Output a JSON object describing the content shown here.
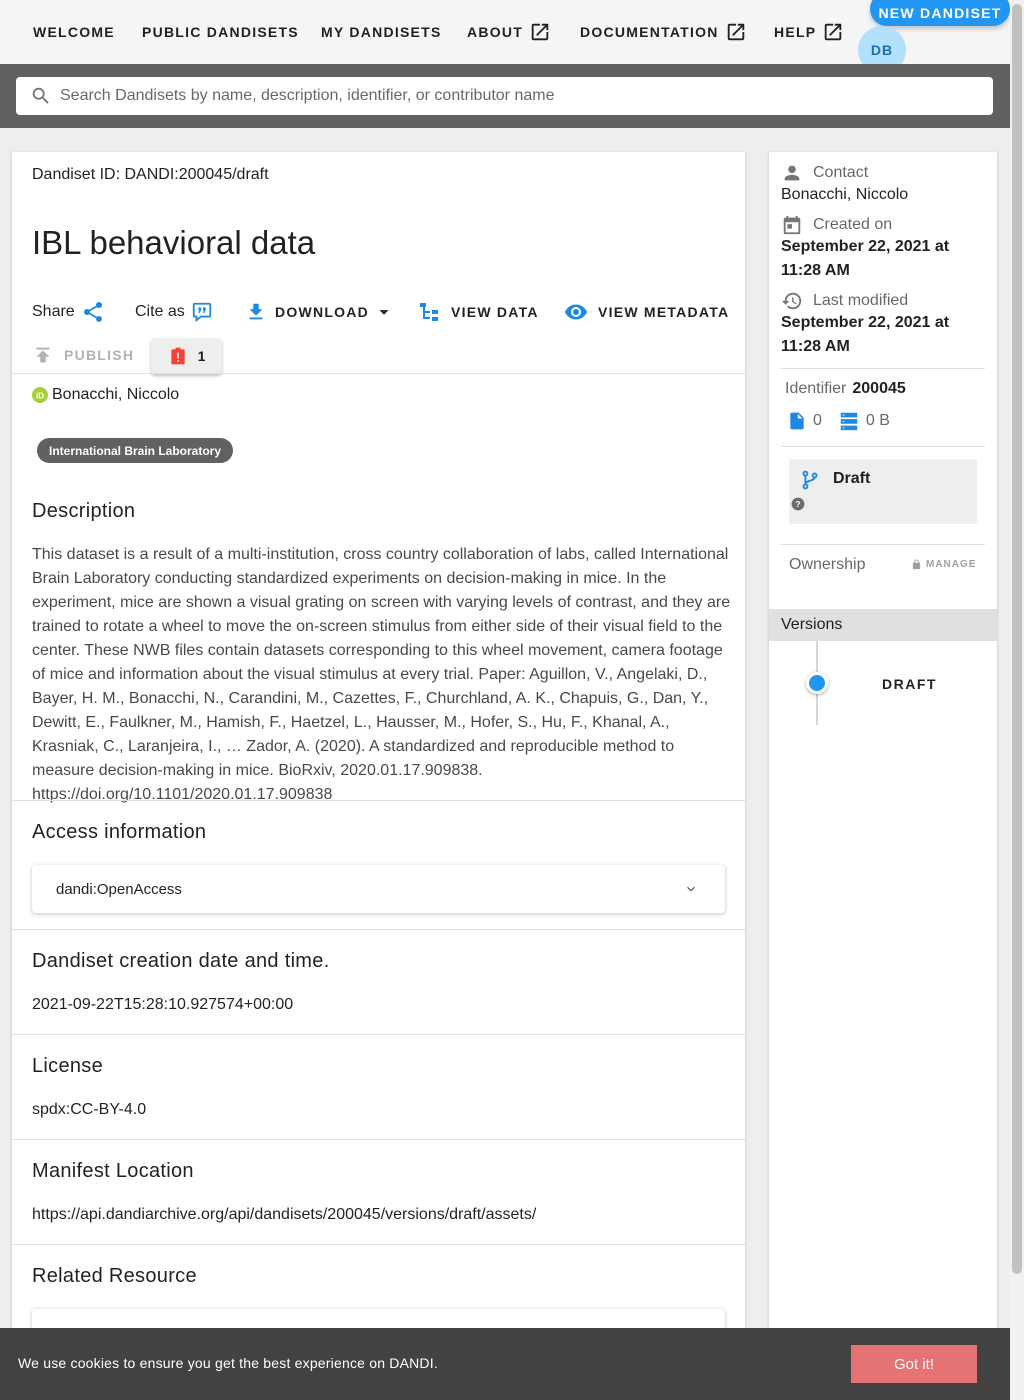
{
  "nav": {
    "items": [
      {
        "label": "WELCOME",
        "external": false
      },
      {
        "label": "PUBLIC DANDISETS",
        "external": false
      },
      {
        "label": "MY DANDISETS",
        "external": false
      },
      {
        "label": "ABOUT",
        "external": true
      },
      {
        "label": "DOCUMENTATION",
        "external": true
      },
      {
        "label": "HELP",
        "external": true
      }
    ],
    "new_button": "NEW DANDISET",
    "avatar_initials": "DB"
  },
  "search": {
    "placeholder": "Search Dandisets by name, description, identifier, or contributor name",
    "value": ""
  },
  "main": {
    "dandiset_id": "Dandiset ID: DANDI:200045/draft",
    "title": "IBL behavioral data",
    "actions": {
      "share": "Share",
      "cite": "Cite as",
      "download": "DOWNLOAD",
      "view_data": "VIEW DATA",
      "view_metadata": "VIEW METADATA",
      "publish": "PUBLISH",
      "error_count": "1"
    },
    "contributor": "Bonacchi, Niccolo",
    "affiliation_chip": "International Brain Laboratory",
    "description_title": "Description",
    "description": "This dataset is a result of a multi-institution, cross country collaboration of labs, called International Brain Laboratory conducting standardized experiments on decision-making in mice. In the experiment, mice are shown a visual grating on screen with varying levels of contrast, and they are trained to rotate a wheel to move the on-screen stimulus from either side of their visual field to the center. These NWB files contain datasets corresponding to this wheel movement, camera footage of mice and information about the visual stimulus at every trial. Paper: Aguillon, V., Angelaki, D., Bayer, H. M., Bonacchi, N., Carandini, M., Cazettes, F., Churchland, A. K., Chapuis, G., Dan, Y., Dewitt, E., Faulkner, M., Hamish, F., Haetzel, L., Hausser, M., Hofer, S., Hu, F., Khanal, A., Krasniak, C., Laranjeira, I., … Zador, A. (2020). A standardized and reproducible method to measure decision-making in mice. BioRxiv, 2020.01.17.909838. https://doi.org/10.1101/2020.01.17.909838",
    "access": {
      "title": "Access information",
      "value": "dandi:OpenAccess"
    },
    "creation": {
      "title": "Dandiset creation date and time.",
      "value": "2021-09-22T15:28:10.927574+00:00"
    },
    "license": {
      "title": "License",
      "value": "spdx:CC-BY-4.0"
    },
    "manifest": {
      "title": "Manifest Location",
      "value": "https://api.dandiarchive.org/api/dandisets/200045/versions/draft/assets/"
    },
    "related": {
      "title": "Related Resource"
    }
  },
  "side": {
    "contact_label": "Contact",
    "contact_value": "Bonacchi, Niccolo",
    "created_label": "Created on",
    "created_value": "September 22, 2021 at 11:28 AM",
    "modified_label": "Last modified",
    "modified_value": "September 22, 2021 at 11:28 AM",
    "identifier_label": "Identifier",
    "identifier_value": "200045",
    "file_count": "0",
    "size": "0 B",
    "draft_label": "Draft",
    "ownership_label": "Ownership",
    "manage_label": "MANAGE",
    "versions_label": "Versions",
    "version_item": "DRAFT"
  },
  "cookie": {
    "message": "We use cookies to ensure you get the best experience on DANDI.",
    "button": "Got it!"
  },
  "colors": {
    "accent": "#2196f3",
    "icon_blue": "#1e88e5",
    "error_red": "#f44336",
    "cookie_button": "#e57373",
    "orcid_green": "#a6ce39"
  }
}
